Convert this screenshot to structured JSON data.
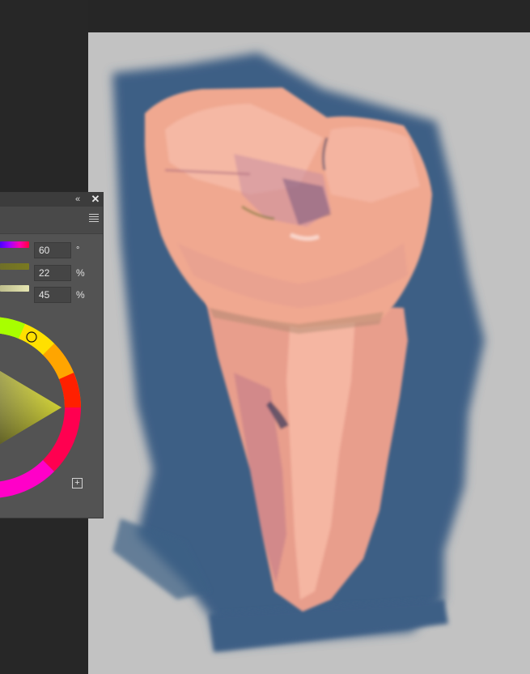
{
  "color_panel": {
    "collapse_icon": "«",
    "close_icon": "✕",
    "hue": {
      "value": "60",
      "unit": "°"
    },
    "saturation": {
      "value": "22",
      "unit": "%"
    },
    "value": {
      "value": "45",
      "unit": "%"
    },
    "add_swatch_icon": "+",
    "colors": {
      "selected": "#737326",
      "hue_pure": "#ffff00",
      "panel_bg": "#535353"
    }
  },
  "canvas": {
    "background": "#c2c2c2",
    "painting_colors": {
      "backdrop_blue": "#3d5f85",
      "tooth_skin": "#f0a890",
      "tooth_highlight": "#f8c2b2",
      "tooth_shadow": "#c07888"
    }
  }
}
